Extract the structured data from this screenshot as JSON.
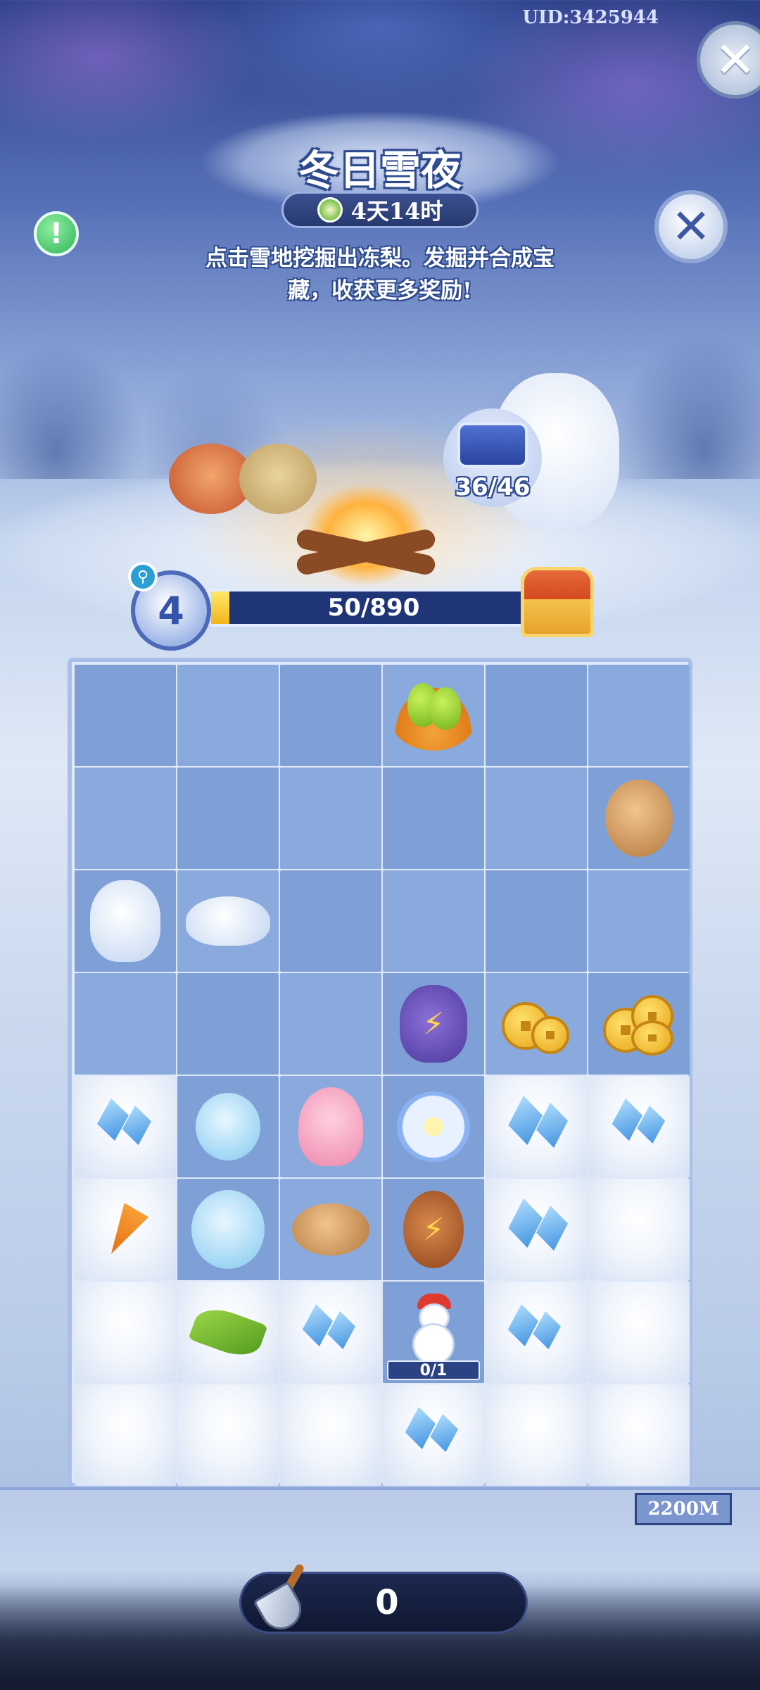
{
  "header": {
    "uid": "UID:3425944",
    "title": "冬日雪夜",
    "timer": "4天14时",
    "description_line1": "点击雪地挖掘出冻梨。发掘并合成宝",
    "description_line2": "藏，收获更多奖励!"
  },
  "scene": {
    "scroll_counter": "36/46"
  },
  "progress": {
    "level": "4",
    "text": "50/890",
    "current": 50,
    "max": 890
  },
  "board": {
    "rows": 8,
    "cols": 6,
    "snowman_counter": "0/1"
  },
  "footer": {
    "depth": "2200M",
    "shovel_count": "0"
  },
  "colors": {
    "board_cell": "#7fa0d7",
    "progress_bg": "#1f3577",
    "progress_fill": "#f2b51a"
  }
}
